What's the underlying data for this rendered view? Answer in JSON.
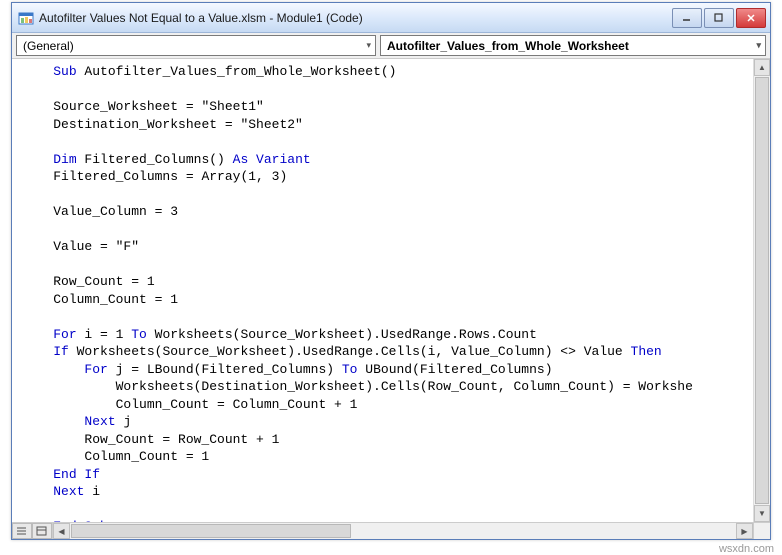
{
  "title": "Autofilter Values Not Equal to a Value.xlsm - Module1 (Code)",
  "dropdowns": {
    "object": "(General)",
    "procedure": "Autofilter_Values_from_Whole_Worksheet"
  },
  "code": {
    "l1a": "Sub",
    "l1b": " Autofilter_Values_from_Whole_Worksheet()",
    "l2": "Source_Worksheet = \"Sheet1\"",
    "l3": "Destination_Worksheet = \"Sheet2\"",
    "l4a": "Dim",
    "l4b": " Filtered_Columns() ",
    "l4c": "As Variant",
    "l5": "Filtered_Columns = Array(1, 3)",
    "l6": "Value_Column = 3",
    "l7": "Value = \"F\"",
    "l8": "Row_Count = 1",
    "l9": "Column_Count = 1",
    "l10a": "For",
    "l10b": " i = 1 ",
    "l10c": "To",
    "l10d": " Worksheets(Source_Worksheet).UsedRange.Rows.Count",
    "l11a": "    ",
    "l11b": "If",
    "l11c": " Worksheets(Source_Worksheet).UsedRange.Cells(i, Value_Column) <> Value ",
    "l11d": "Then",
    "l12a": "        ",
    "l12b": "For",
    "l12c": " j = LBound(Filtered_Columns) ",
    "l12d": "To",
    "l12e": " UBound(Filtered_Columns)",
    "l13": "            Worksheets(Destination_Worksheet).Cells(Row_Count, Column_Count) = Workshe",
    "l14": "            Column_Count = Column_Count + 1",
    "l15a": "        ",
    "l15b": "Next",
    "l15c": " j",
    "l16": "        Row_Count = Row_Count + 1",
    "l17": "        Column_Count = 1",
    "l18a": "    ",
    "l18b": "End If",
    "l19a": "Next",
    "l19b": " i",
    "l20": "End Sub"
  },
  "watermark": "wsxdn.com"
}
